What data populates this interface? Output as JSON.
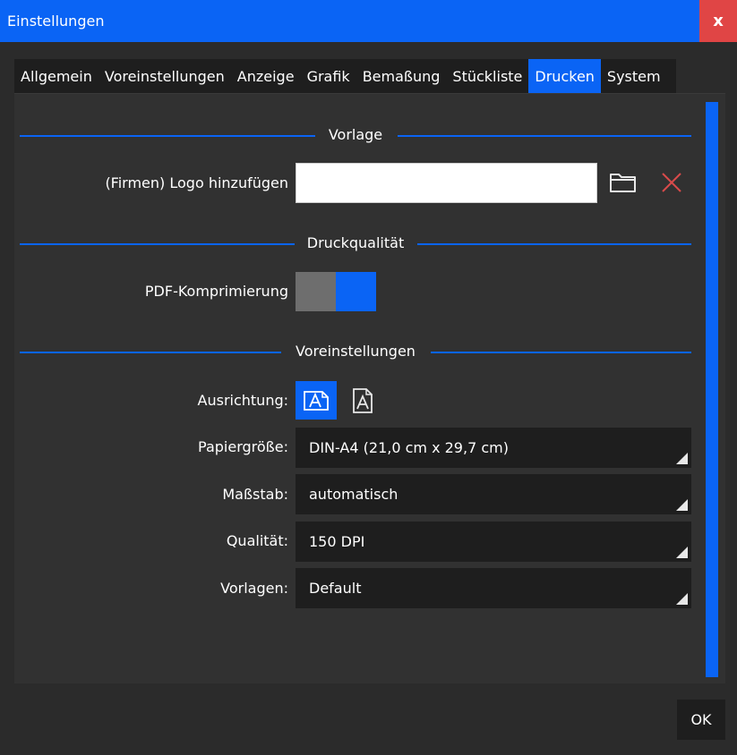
{
  "window": {
    "title": "Einstellungen",
    "close_label": "x"
  },
  "tabs": [
    {
      "label": "Allgemein"
    },
    {
      "label": "Voreinstellungen"
    },
    {
      "label": "Anzeige"
    },
    {
      "label": "Grafik"
    },
    {
      "label": "Bemaßung"
    },
    {
      "label": "Stückliste"
    },
    {
      "label": "Drucken",
      "active": true
    },
    {
      "label": "System"
    }
  ],
  "sections": {
    "vorlage": "Vorlage",
    "druckqualitaet": "Druckqualität",
    "voreinstellungen": "Voreinstellungen"
  },
  "logo": {
    "label": "(Firmen) Logo hinzufügen",
    "value": ""
  },
  "pdf_compression": {
    "label": "PDF-Komprimierung",
    "enabled": true
  },
  "orientation": {
    "label": "Ausrichtung:",
    "selected": "landscape"
  },
  "paper_size": {
    "label": "Papiergröße:",
    "value": "DIN-A4 (21,0 cm x 29,7 cm)"
  },
  "scale": {
    "label": "Maßstab:",
    "value": "automatisch"
  },
  "quality": {
    "label": "Qualität:",
    "value": "150 DPI"
  },
  "templates": {
    "label": "Vorlagen:",
    "value": "Default"
  },
  "ok_label": "OK",
  "colors": {
    "accent": "#0a64f5",
    "close": "#e04545",
    "delete": "#d94a4a"
  },
  "icons": {
    "folder": "folder-icon",
    "delete": "close-icon",
    "orient_landscape": "orientation-landscape-icon",
    "orient_portrait": "orientation-portrait-icon"
  }
}
